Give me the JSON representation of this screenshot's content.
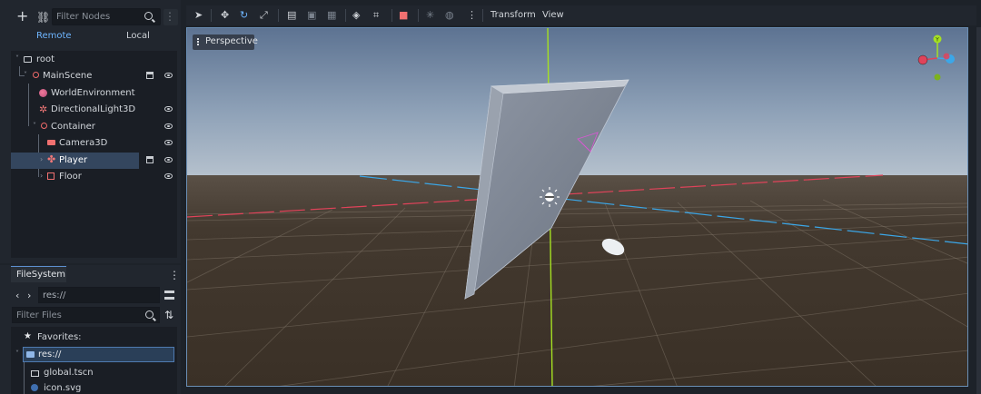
{
  "scene_dock": {
    "filter_placeholder": "Filter Nodes",
    "tabs": {
      "remote": "Remote",
      "local": "Local"
    },
    "tree": [
      {
        "label": "root",
        "icon": "root-icon"
      },
      {
        "label": "MainScene",
        "icon": "node3d-icon"
      },
      {
        "label": "WorldEnvironment",
        "icon": "world-environment-icon"
      },
      {
        "label": "DirectionalLight3D",
        "icon": "directional-light-icon"
      },
      {
        "label": "Container",
        "icon": "node3d-icon"
      },
      {
        "label": "Camera3D",
        "icon": "camera-icon"
      },
      {
        "label": "Player",
        "icon": "character-body-icon",
        "selected": true
      },
      {
        "label": "Floor",
        "icon": "static-body-icon"
      }
    ]
  },
  "filesystem": {
    "tab_label": "FileSystem",
    "path": "res://",
    "filter_placeholder": "Filter Files",
    "favorites_label": "Favorites:",
    "items": [
      {
        "label": "res://",
        "icon": "folder-icon",
        "selected": true
      },
      {
        "label": "global.tscn",
        "icon": "scene-file-icon"
      },
      {
        "label": "icon.svg",
        "icon": "svg-file-icon"
      }
    ]
  },
  "viewport_toolbar": {
    "menus": {
      "transform": "Transform",
      "view": "View"
    }
  },
  "viewport": {
    "perspective_label": "Perspective",
    "gizmo_axis_y": "Y",
    "colors": {
      "x_axis": "#e0435a",
      "y_axis": "#a5e022",
      "z_axis": "#3ba7e8",
      "accent": "#6eb5ff"
    }
  }
}
